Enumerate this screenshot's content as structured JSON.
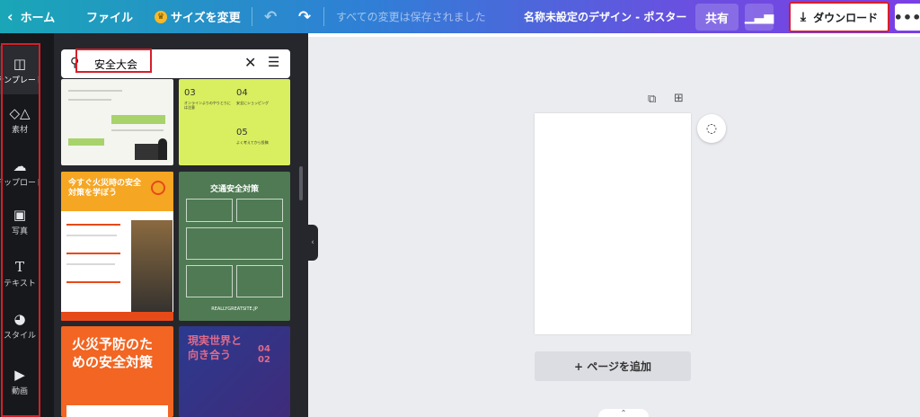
{
  "topbar": {
    "home_label": "ホーム",
    "file_label": "ファイル",
    "resize_label": "サイズを変更",
    "save_status": "すべての変更は保存されました",
    "design_title": "名称未設定のデザイン - ポスター",
    "share_label": "共有",
    "download_label": "ダウンロード",
    "more_label": "•••"
  },
  "sidebar": {
    "items": [
      {
        "label": "テンプレート",
        "icon": "template-icon"
      },
      {
        "label": "素材",
        "icon": "elements-icon"
      },
      {
        "label": "アップロード",
        "icon": "upload-icon"
      },
      {
        "label": "写真",
        "icon": "photo-icon"
      },
      {
        "label": "テキスト",
        "icon": "text-icon"
      },
      {
        "label": "スタイル",
        "icon": "palette-icon"
      },
      {
        "label": "動画",
        "icon": "video-icon"
      }
    ]
  },
  "search": {
    "value": "安全大会"
  },
  "templates": {
    "t2": {
      "n1": "03",
      "n2": "04",
      "n3": "05",
      "c1": "オンラインよりのやりとりには注意",
      "c2": "安全にショッピング",
      "c3": "よく考えてから投稿"
    },
    "t3": {
      "title": "今すぐ火災時の安全対策を学ぼう"
    },
    "t4": {
      "title": "交通安全対策",
      "footer": "REALLYGREATSITE.JP"
    },
    "t5": {
      "title": "火災予防のための安全対策"
    },
    "t6": {
      "title": "現実世界と向き合う",
      "date": "04 02"
    }
  },
  "canvas": {
    "add_page_label": "+ ページを追加"
  },
  "colors": {
    "accent_red": "#d81e2a",
    "rail_bg": "#17181b",
    "panel_bg": "#25272c"
  }
}
